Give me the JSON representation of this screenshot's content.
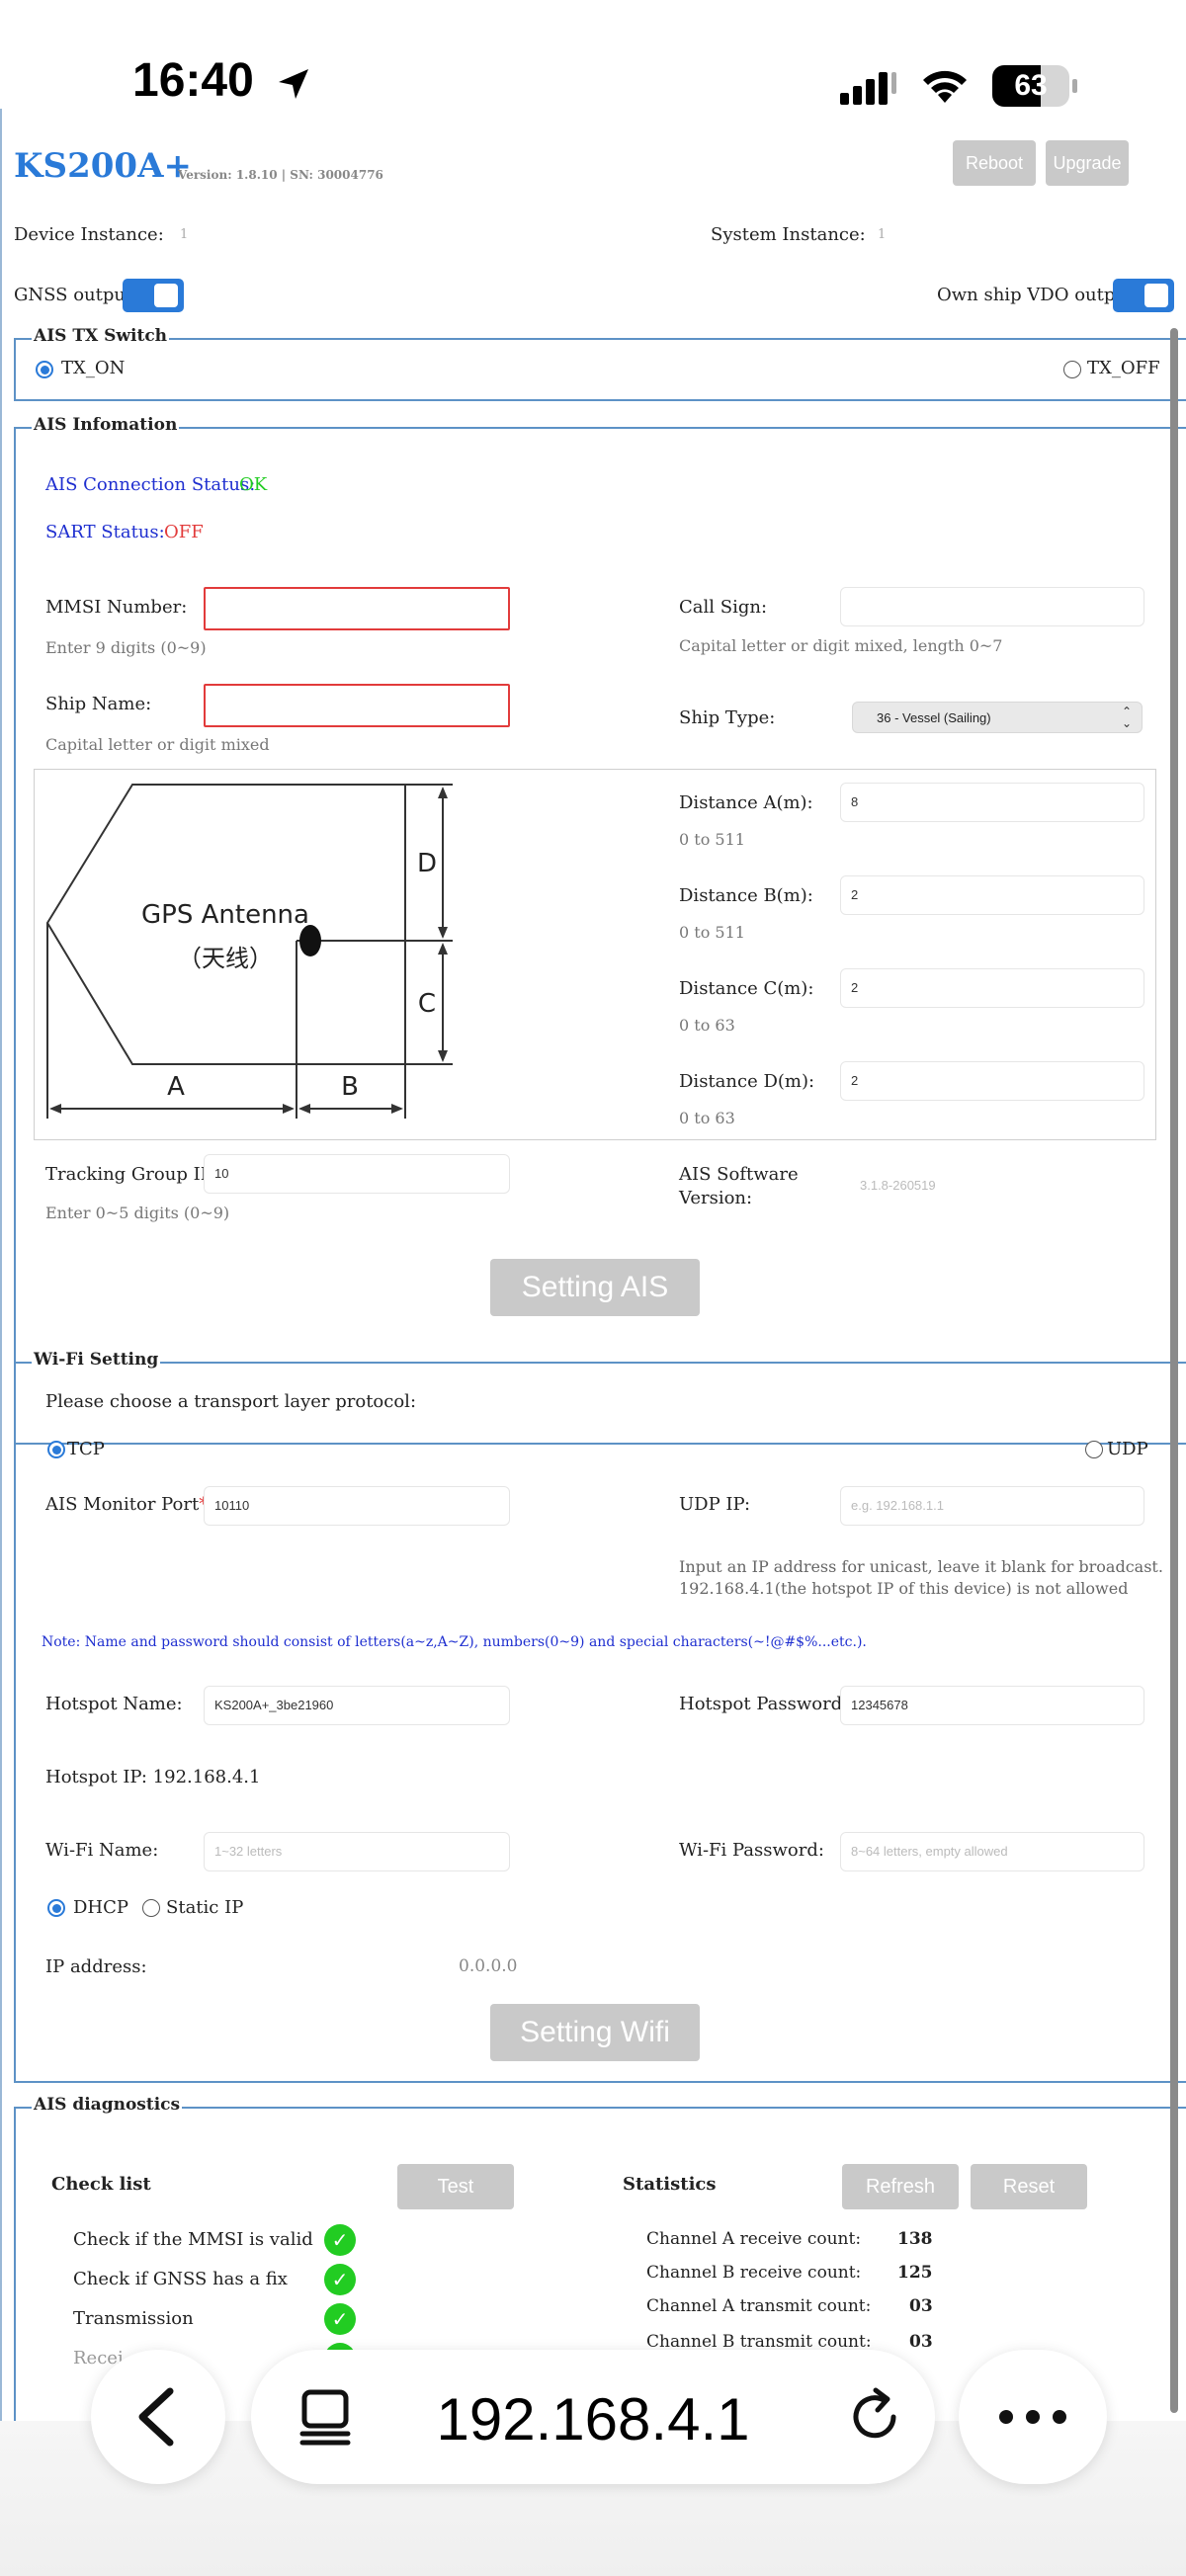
{
  "status_bar": {
    "time": "16:40",
    "battery": "63"
  },
  "header": {
    "title": "KS200A+",
    "version": "Version: 1.8.10 | SN: 30004776",
    "reboot_label": "Reboot",
    "upgrade_label": "Upgrade"
  },
  "instances": {
    "device_label": "Device Instance:",
    "device_value": "1",
    "system_label": "System Instance:",
    "system_value": "1"
  },
  "outputs": {
    "gnss_label": "GNSS output",
    "gnss_on": true,
    "vdo_label": "Own ship VDO output",
    "vdo_on": true
  },
  "tx_switch": {
    "legend": "AIS TX Switch",
    "on_label": "TX_ON",
    "off_label": "TX_OFF",
    "selected": "TX_ON"
  },
  "ais_info": {
    "legend": "AIS Infomation",
    "connection_label": "AIS Connection Status:",
    "connection_value": "OK",
    "sart_label": "SART Status:",
    "sart_value": "OFF",
    "mmsi_label": "MMSI Number:",
    "mmsi_value": "",
    "mmsi_hint": "Enter 9 digits (0~9)",
    "callsign_label": "Call Sign:",
    "callsign_value": "",
    "callsign_hint": "Capital letter or digit mixed, length 0~7",
    "shipname_label": "Ship Name:",
    "shipname_value": "",
    "shipname_hint": "Capital letter or digit mixed",
    "shiptype_label": "Ship Type:",
    "shiptype_value": "36 - Vessel (Sailing)",
    "diagram": {
      "antenna_label": "GPS Antenna",
      "antenna_cn": "（天线）",
      "a": "A",
      "b": "B",
      "c": "C",
      "d": "D"
    },
    "distances": [
      {
        "label": "Distance A(m):",
        "value": "8",
        "hint": "0 to 511"
      },
      {
        "label": "Distance B(m):",
        "value": "2",
        "hint": "0 to 511"
      },
      {
        "label": "Distance C(m):",
        "value": "2",
        "hint": "0 to 63"
      },
      {
        "label": "Distance D(m):",
        "value": "2",
        "hint": "0 to 63"
      }
    ],
    "tracking_label": "Tracking Group ID:",
    "tracking_value": "10",
    "tracking_hint": "Enter 0~5 digits (0~9)",
    "software_label_1": "AIS Software",
    "software_label_2": "Version:",
    "software_value": "3.1.8-260519",
    "setting_button": "Setting AIS"
  },
  "wifi": {
    "legend": "Wi-Fi Setting",
    "protocol_prompt": "Please choose a transport layer protocol:",
    "tcp_label": "TCP",
    "udp_label": "UDP",
    "protocol_selected": "TCP",
    "port_label": "AIS Monitor Port",
    "port_required": "*",
    "port_colon": ":",
    "port_value": "10110",
    "udp_ip_label": "UDP IP:",
    "udp_ip_placeholder": "e.g. 192.168.1.1",
    "udp_note_1": "Input an IP address for unicast, leave it blank for broadcast.",
    "udp_note_2": "192.168.4.1(the hotspot IP of this device) is not allowed",
    "note": "Note: Name and password should consist of letters(a~z,A~Z), numbers(0~9) and special characters(~!@#$%...etc.).",
    "hotspot_name_label": "Hotspot Name:",
    "hotspot_name_value": "KS200A+_3be21960",
    "hotspot_pw_label": "Hotspot Password:",
    "hotspot_pw_value": "12345678",
    "hotspot_ip": "Hotspot IP: 192.168.4.1",
    "wifi_name_label": "Wi-Fi Name:",
    "wifi_name_placeholder": "1~32 letters",
    "wifi_pw_label": "Wi-Fi Password:",
    "wifi_pw_placeholder": "8~64 letters, empty allowed",
    "dhcp_label": "DHCP",
    "static_label": "Static IP",
    "ip_mode_selected": "DHCP",
    "ip_label": "IP address:",
    "ip_value": "0.0.0.0",
    "setting_button": "Setting Wifi"
  },
  "diagnostics": {
    "legend": "AIS diagnostics",
    "checklist_title": "Check list",
    "test_button": "Test",
    "checks": [
      {
        "label": "Check if the MMSI is valid",
        "ok": true
      },
      {
        "label": "Check if GNSS has a fix",
        "ok": true
      },
      {
        "label": "Transmission",
        "ok": true
      },
      {
        "label": "Recei",
        "ok": true
      }
    ],
    "statistics_title": "Statistics",
    "refresh_button": "Refresh",
    "reset_button": "Reset",
    "stats": [
      {
        "label": "Channel A receive count:",
        "value": "138"
      },
      {
        "label": "Channel B receive count:",
        "value": "125"
      },
      {
        "label": "Channel A transmit count:",
        "value": "03"
      },
      {
        "label": "Channel B transmit count:",
        "value": "03"
      }
    ]
  },
  "browser": {
    "url": "192.168.4.1",
    "back_icon": "chevron-left-icon",
    "tabs_icon": "tabs-icon",
    "reload_icon": "reload-icon",
    "more_icon": "more-icon"
  },
  "colors": {
    "accent": "#2a7ad8",
    "ok": "#22cc22",
    "off": "#e23b3b",
    "link_blue": "#1f2fd0",
    "button_gray": "#c9c9c9"
  }
}
